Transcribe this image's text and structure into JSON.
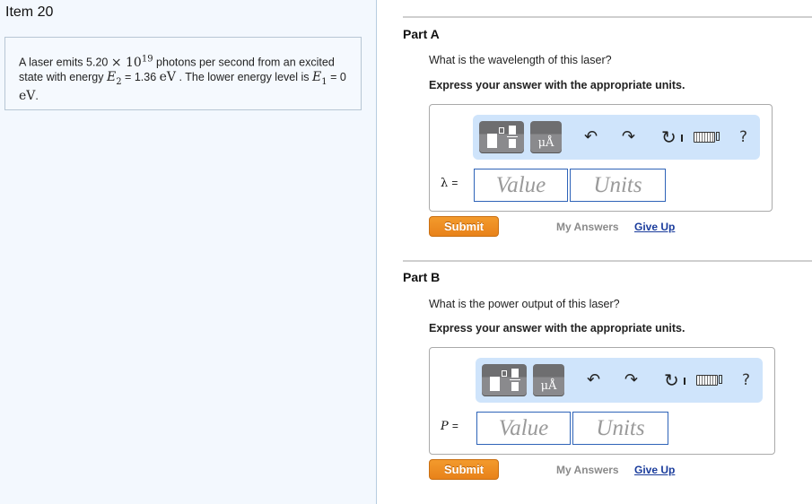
{
  "left": {
    "item_title": "Item 20",
    "problem": {
      "t1": "A laser emits 5.20 ",
      "times": "×",
      "base": "10",
      "exp": "19",
      "t2": " photons per second from an excited state with energy ",
      "E2_sym": "E",
      "E2_sub": "2",
      "t3": " = 1.36 ",
      "unit1": "eV",
      "t4": " . The lower energy level is ",
      "E1_sym": "E",
      "E1_sub": "1",
      "t5": " = 0 ",
      "unit2": "eV",
      "t6": "."
    }
  },
  "parts": [
    {
      "title": "Part A",
      "question": "What is the wavelength of this laser?",
      "instruction": "Express your answer with the appropriate units.",
      "variable": "λ",
      "equals": "=",
      "value_placeholder": "Value",
      "units_placeholder": "Units",
      "submit_label": "Submit",
      "my_answers_label": "My Answers",
      "give_up_label": "Give Up"
    },
    {
      "title": "Part B",
      "question": "What is the power output of this laser?",
      "instruction": "Express your answer with the appropriate units.",
      "variable": "P",
      "equals": "=",
      "value_placeholder": "Value",
      "units_placeholder": "Units",
      "submit_label": "Submit",
      "my_answers_label": "My Answers",
      "give_up_label": "Give Up"
    }
  ],
  "toolbar": {
    "units_label": "μÅ",
    "undo_icon": "↶",
    "redo_icon": "↷",
    "reset_icon": "↻",
    "help_label": "?"
  },
  "colors": {
    "submit": "#ef8c22",
    "give_up_link": "#1a3c9c",
    "toolbar_bg": "#cfe4fb",
    "field_border": "#2e63b8"
  }
}
